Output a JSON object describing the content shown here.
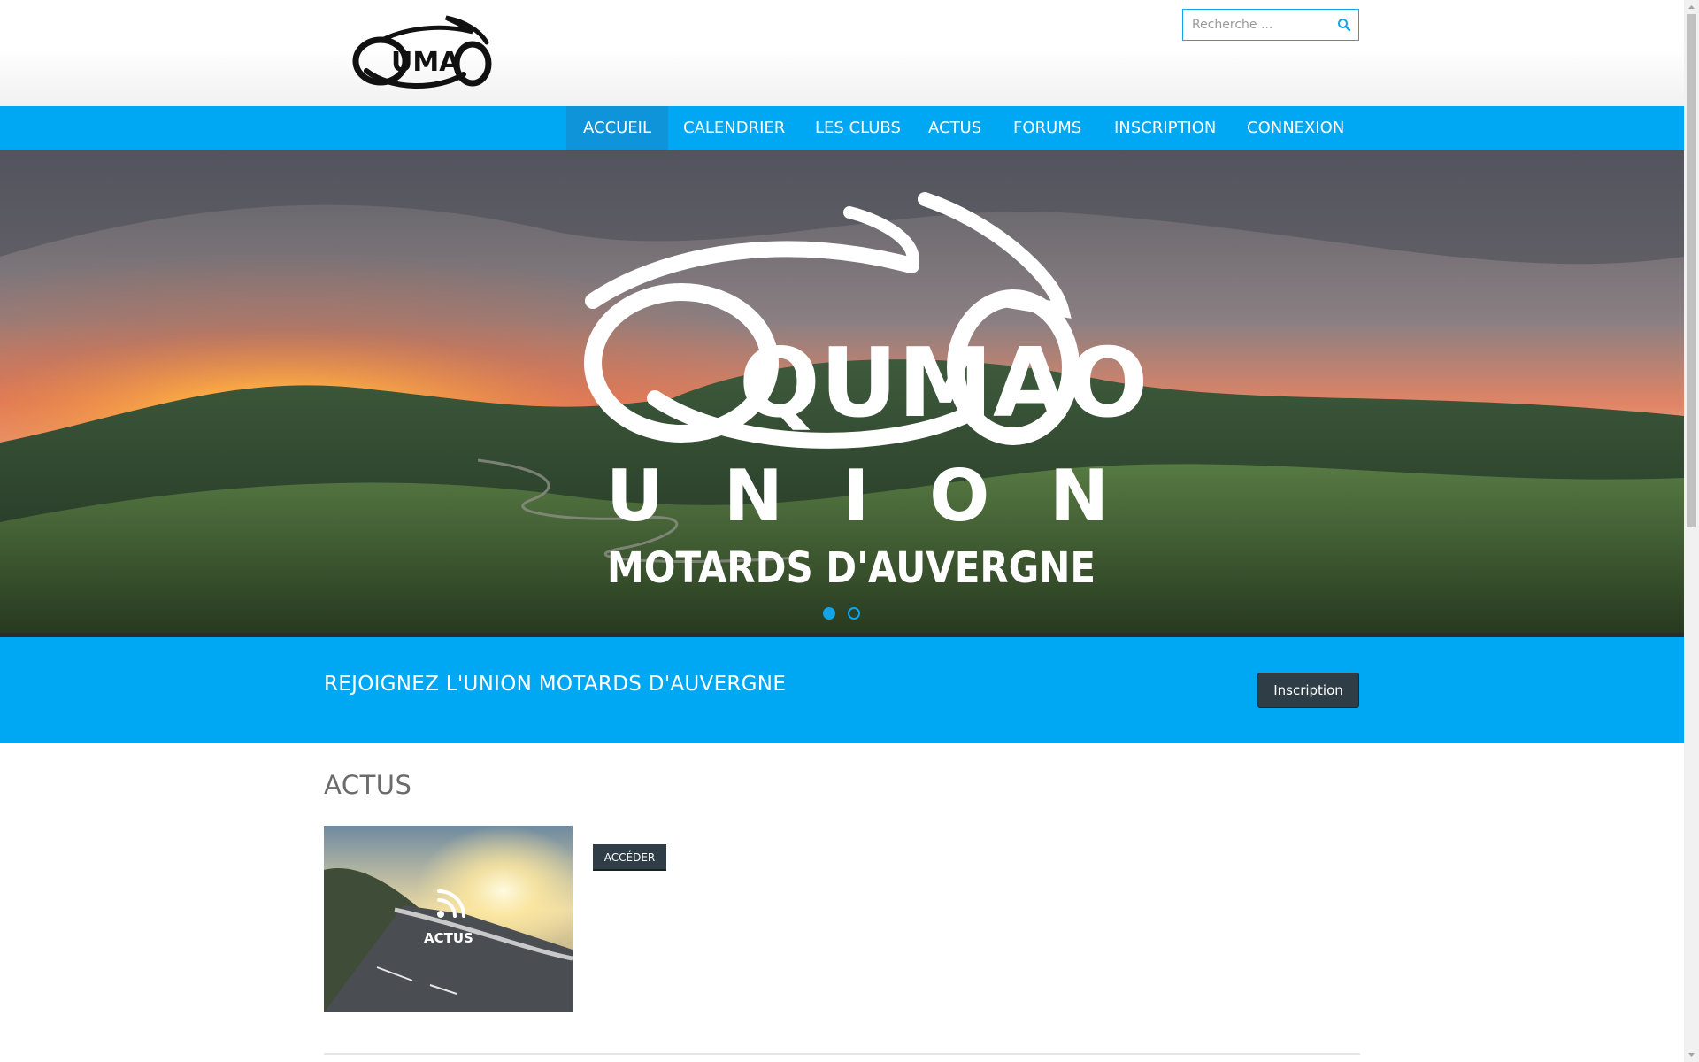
{
  "brand": {
    "logo_text": "QUMAO"
  },
  "search": {
    "placeholder": "Recherche ..."
  },
  "nav": {
    "items": [
      {
        "label": "ACCUEIL",
        "active": true
      },
      {
        "label": "CALENDRIER"
      },
      {
        "label": "LES CLUBS"
      },
      {
        "label": "ACTUS"
      },
      {
        "label": "FORUMS"
      },
      {
        "label": "INSCRIPTION"
      },
      {
        "label": "CONNEXION"
      }
    ]
  },
  "hero": {
    "logo_text": "QUMAO",
    "line1": "U N I O N",
    "line2": "MOTARDS D'AUVERGNE",
    "slides": 2,
    "active_slide": 1
  },
  "join": {
    "title": "REJOIGNEZ L'UNION MOTARDS D'AUVERGNE",
    "button": "Inscription"
  },
  "actus": {
    "title": "ACTUS",
    "thumb_label": "ACTUS",
    "button": "ACCÉDER"
  },
  "colors": {
    "accent": "#00a8f3",
    "dark_button": "#2f3d46",
    "nav_active": "#1094d9"
  }
}
